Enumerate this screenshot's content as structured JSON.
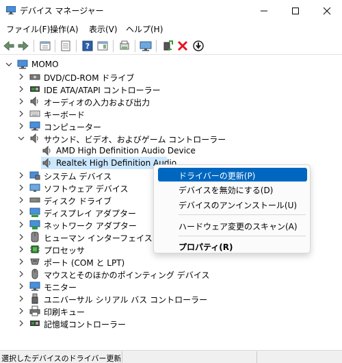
{
  "window": {
    "title": "デバイス マネージャー"
  },
  "menubar": {
    "items": [
      "ファイル(F)",
      "操作(A)",
      "表示(V)",
      "ヘルプ(H)"
    ]
  },
  "toolbar": {
    "buttons": [
      "back-arrow-icon",
      "forward-arrow-icon",
      "properties-view-icon",
      "details-icon",
      "help-icon",
      "panel-icon",
      "refresh-icon",
      "monitor-icon",
      "add-driver-icon",
      "uninstall-x-icon",
      "download-arrow-icon"
    ]
  },
  "tree": {
    "root": "MOMO",
    "categories": [
      "DVD/CD-ROM ドライブ",
      "IDE ATA/ATAPI コントローラー",
      "オーディオの入力および出力",
      "キーボード",
      "コンピューター",
      "サウンド、ビデオ、およびゲーム コントローラー",
      "システム デバイス",
      "ソフトウェア デバイス",
      "ディスク ドライブ",
      "ディスプレイ アダプター",
      "ネットワーク アダプター",
      "ヒューマン インターフェイス デバイス",
      "プロセッサ",
      "ポート (COM と LPT)",
      "マウスとそのほかのポインティング デバイス",
      "モニター",
      "ユニバーサル シリアル バス コントローラー",
      "印刷キュー",
      "記憶域コントローラー"
    ],
    "sound_children": [
      "AMD High Definition Audio Device",
      "Realtek High Definition Audio"
    ]
  },
  "context_menu": {
    "update_driver": "ドライバーの更新(P)",
    "disable_device": "デバイスを無効にする(D)",
    "uninstall_device": "デバイスのアンインストール(U)",
    "scan_hardware": "ハードウェア変更のスキャン(A)",
    "properties": "プロパティ(R)"
  },
  "status": {
    "text": "選択したデバイスのドライバー更新ウィ"
  },
  "colors": {
    "selection": "#cce8ff",
    "highlight": "#0067c0",
    "accent_red": "#e81123",
    "accent_green": "#2c9d2c"
  }
}
